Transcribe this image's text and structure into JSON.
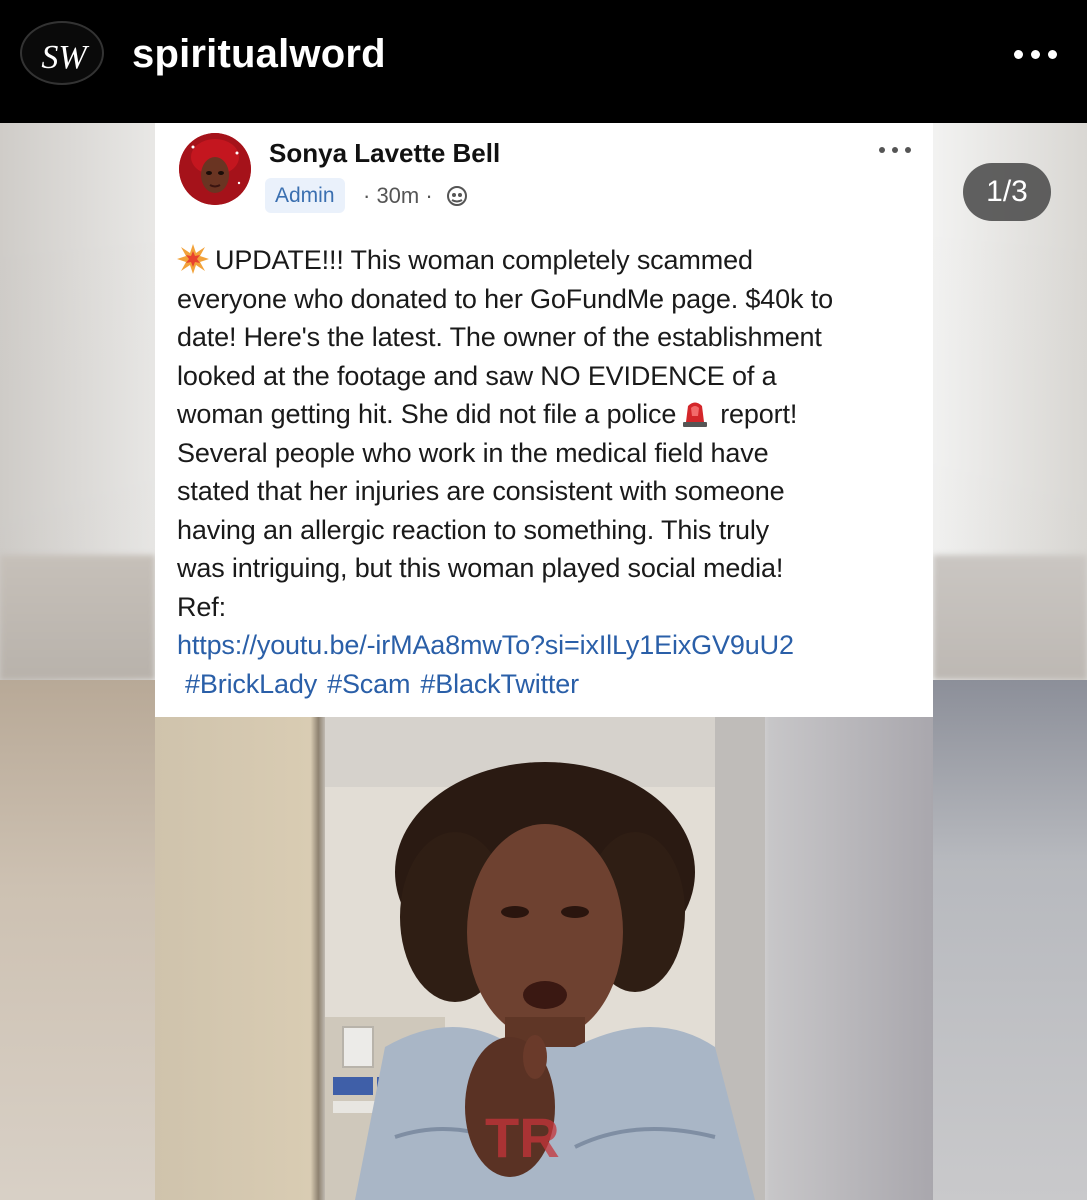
{
  "header": {
    "account_logo": "SW",
    "username": "spiritualword",
    "more_icon": "more-horizontal-icon"
  },
  "carousel": {
    "counter": "1/3"
  },
  "post": {
    "author": "Sonya Lavette Bell",
    "role_badge": "Admin",
    "time": "· 30m ·",
    "privacy_icon": "globe-icon",
    "body_lines": [
      "UPDATE!!! This woman completely scammed",
      "everyone who donated to her GoFundMe page. $40k to",
      "date! Here's the latest. The owner of the establishment",
      "looked at the footage and saw NO EVIDENCE of a",
      "woman getting hit. She did not file a police",
      "report!",
      "Several people who work in the medical field have",
      "stated that her injuries are consistent with someone",
      "having an allergic reaction to something. This truly",
      "was intriguing, but this woman played social media!",
      "Ref:"
    ],
    "link": "https://youtu.be/-irMAa8mwTo?si=ixIlLy1EixGV9uU2",
    "hashtags": [
      "#BrickLady",
      "#Scam",
      "#BlackTwitter"
    ]
  },
  "media": {
    "watermark": "TR"
  },
  "colors": {
    "link": "#2a5fa8",
    "badge_bg": "#eaf1fb",
    "badge_text": "#3a6fb0",
    "topbar": "#000000"
  }
}
